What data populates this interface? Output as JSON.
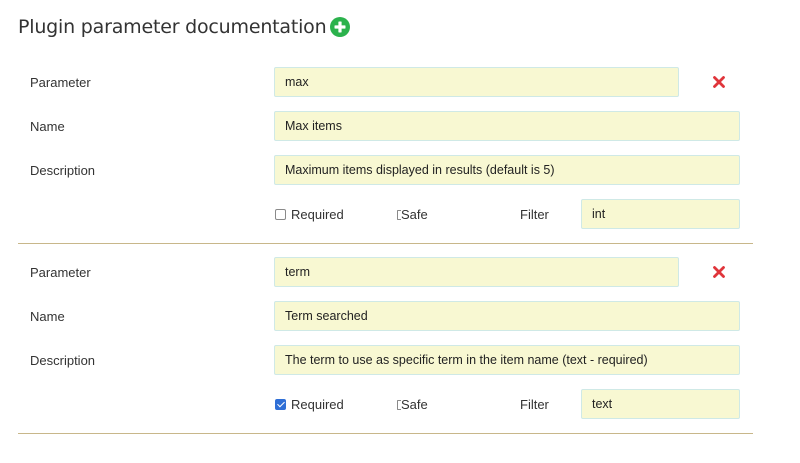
{
  "page": {
    "title": "Plugin parameter documentation",
    "add_icon": "plus-circle-icon",
    "accent_color": "#2bb24c",
    "remove_color": "#e0353b"
  },
  "labels": {
    "parameter": "Parameter",
    "name": "Name",
    "description": "Description",
    "required": "Required",
    "safe": "Safe",
    "filter": "Filter"
  },
  "params": [
    {
      "parameter": "max",
      "name": "Max items",
      "description": "Maximum items displayed in results (default is 5)",
      "required": false,
      "filter": "int"
    },
    {
      "parameter": "term",
      "name": "Term searched",
      "description": "The term to use as specific term in the item name (text - required)",
      "required": true,
      "filter": "text"
    }
  ]
}
